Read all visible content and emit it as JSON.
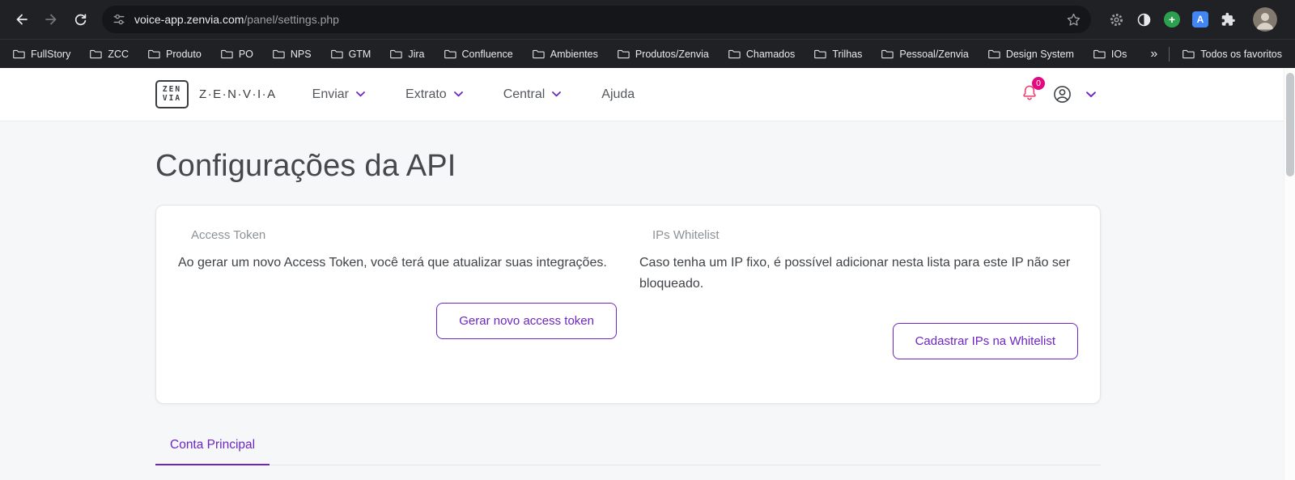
{
  "colors": {
    "accent": "#6d26c4",
    "badge": "#e5097f",
    "bell": "#ee3d6e"
  },
  "browser": {
    "url": {
      "domain": "voice-app.zenvia.com",
      "path": "/panel/settings.php"
    },
    "bookmarks": [
      "FullStory",
      "ZCC",
      "Produto",
      "PO",
      "NPS",
      "GTM",
      "Jira",
      "Confluence",
      "Ambientes",
      "Produtos/Zenvia",
      "Chamados",
      "Trilhas",
      "Pessoal/Zenvia",
      "Design System",
      "IOs"
    ],
    "overflow_chevron": "»",
    "all_favorites_label": "Todos os favoritos",
    "translate_glyph": "A",
    "add_glyph": "+"
  },
  "header": {
    "logo_box_line1": "ZEN",
    "logo_box_line2": "VIA",
    "logo_wordmark": "Z·E·N·V·I·A",
    "nav_items": [
      {
        "label": "Enviar"
      },
      {
        "label": "Extrato"
      },
      {
        "label": "Central"
      },
      {
        "label": "Ajuda"
      }
    ],
    "notification_count": "0"
  },
  "page": {
    "title": "Configurações da API",
    "access_token": {
      "label": "Access Token",
      "description": "Ao gerar um novo Access Token, você terá que atualizar suas integrações.",
      "button_label": "Gerar novo access token"
    },
    "ips_whitelist": {
      "label": "IPs Whitelist",
      "description": "Caso tenha um IP fixo, é possível adicionar nesta lista para este IP não ser bloqueado.",
      "button_label": "Cadastrar IPs na Whitelist"
    },
    "tabs": [
      {
        "label": "Conta Principal"
      }
    ]
  }
}
